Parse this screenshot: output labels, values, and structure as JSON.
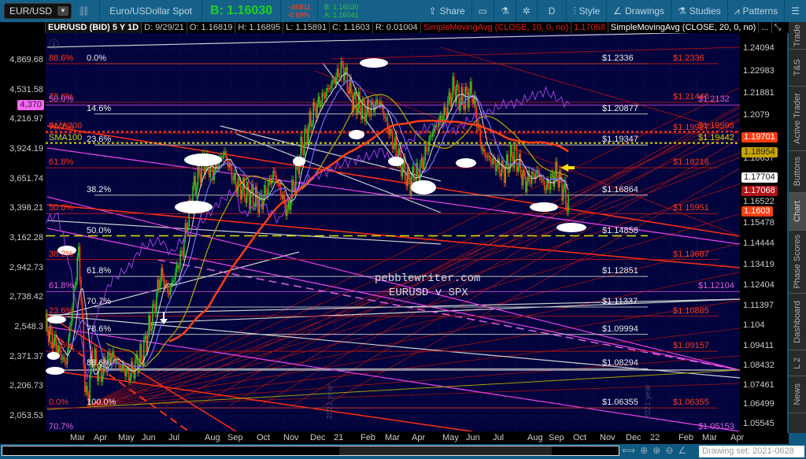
{
  "toolbar": {
    "symbol": "EUR/USD",
    "description": "Euro/USDollar Spot",
    "bid_big": "B: 1.16030",
    "change": "-.00811",
    "change_pct": "-0.69%",
    "bid_small": "B: 1.16030",
    "ask_small": "A: 1.16041",
    "share": "Share",
    "period": "D",
    "style": "Style",
    "drawings": "Drawings",
    "studies": "Studies",
    "patterns": "Patterns"
  },
  "infobar": {
    "title": "EUR/USD (BID) 5 Y 1D",
    "date": "D: 9/29/21",
    "open": "O: 1.16819",
    "high": "H: 1.16895",
    "low": "L: 1.15891",
    "close": "C: 1.1603",
    "range": "R: 0.01004",
    "sma10": "SimpleMovingAvg (CLOSE, 10, 0, no)",
    "sma10_value": "1.17068",
    "sma20": "SimpleMovingAvg (CLOSE, 20, 0, no)",
    "more": "..."
  },
  "left_axis": [
    "4,869.68",
    "4,531.58",
    "4,216.97",
    "3,924.19",
    "3,651.74",
    "3,398.21",
    "3,162.28",
    "2,942.73",
    "2,738.42",
    "2,548.3",
    "2,371.37",
    "2,206.73",
    "2,053.53"
  ],
  "left_tag": {
    "text": "4,370",
    "color": "#ff66ff"
  },
  "right_axis": [
    "1.24094",
    "1.22983",
    "1.21881",
    "1.2079",
    "1.18637",
    "1.16522",
    "1.15478",
    "1.14444",
    "1.13419",
    "1.12404",
    "1.11397",
    "1.104",
    "1.09411",
    "1.08432",
    "1.07461",
    "1.06499",
    "1.05545"
  ],
  "right_tags": [
    {
      "text": "1.19701",
      "color": "#ff3d14",
      "fg": "#fff"
    },
    {
      "text": "1.18954",
      "color": "#c9a400",
      "fg": "#222"
    },
    {
      "text": "1.17704",
      "color": "#ffffff",
      "fg": "#111"
    },
    {
      "text": "1.17068",
      "color": "#b0141a",
      "fg": "#fff"
    },
    {
      "text": "1.1603",
      "color": "#ff3d14",
      "fg": "#fff"
    }
  ],
  "white_fibs": [
    {
      "pct": "0.0%",
      "price": 1.2336,
      "label": "$1.2336"
    },
    {
      "pct": "14.6%",
      "price": 1.20877,
      "label": "$1.20877"
    },
    {
      "pct": "23.6%",
      "price": 1.19347,
      "label": "$1.19347"
    },
    {
      "pct": "38.2%",
      "price": 1.16864,
      "label": "$1.16864"
    },
    {
      "pct": "50.0%",
      "price": 1.14858,
      "label": "$1.14858"
    },
    {
      "pct": "61.8%",
      "price": 1.12851,
      "label": "$1.12851"
    },
    {
      "pct": "70.7%",
      "price": 1.11337,
      "label": "$1.11337"
    },
    {
      "pct": "78.6%",
      "price": 1.09994,
      "label": "$1.09994"
    },
    {
      "pct": "88.6%",
      "price": 1.08294,
      "label": "$1.08294"
    },
    {
      "pct": "100.0%",
      "price": 1.06355,
      "label": "$1.06355"
    }
  ],
  "red_fibs": [
    {
      "pct": "88.6%",
      "price": 1.2336,
      "label": "$1.2336"
    },
    {
      "pct": "78.6%",
      "price": 1.21448,
      "label": "$1.21448"
    },
    {
      "pct": "70.7%",
      "price": 1.19927,
      "label": "$1.19927"
    },
    {
      "pct": "61.8%",
      "price": 1.18216,
      "label": "$1.18216"
    },
    {
      "pct": "50.0%",
      "price": 1.15951,
      "label": "$1.15951"
    },
    {
      "pct": "38.2%",
      "price": 1.13687,
      "label": "$1.13687"
    },
    {
      "pct": "23.6%",
      "price": 1.10885,
      "label": "$1.10885"
    },
    {
      "pct": "14.6%",
      "price": 1.09157,
      "label": "$1.09157"
    },
    {
      "pct": "0.0%",
      "price": 1.06355,
      "label": "$1.06355"
    }
  ],
  "magenta_fibs": [
    {
      "pct": "50.0%",
      "price": 1.2132,
      "label": "$1.2132"
    },
    {
      "pct": "61.8%",
      "price": 1.12104,
      "label": "$1.12104"
    },
    {
      "pct": "70.7%",
      "price": 1.05153,
      "label": "$1.05153"
    }
  ],
  "sma_levels": [
    {
      "name": "SMA200",
      "price": 1.19995,
      "label": "$1.19995",
      "color": "#ff3d14"
    },
    {
      "name": "SMA100",
      "price": 1.19442,
      "label": "$1.19442",
      "color": "#d8d800"
    }
  ],
  "brand": {
    "site": "pebblewriter.com",
    "subtitle": "EURUSD v SPX"
  },
  "watermarks": [
    "2021 year",
    "2021 year"
  ],
  "months": [
    "Mar",
    "Apr",
    "May",
    "Jun",
    "Jul",
    "Aug",
    "Sep",
    "Oct",
    "Nov",
    "Dec",
    "21",
    "Feb",
    "Mar",
    "Apr",
    "May",
    "Jun",
    "Jul",
    "Aug",
    "Sep",
    "Oct",
    "Nov",
    "Dec",
    "22",
    "Feb",
    "Mar",
    "Apr"
  ],
  "tabs": [
    {
      "label": "Trade",
      "selected": false
    },
    {
      "label": "T&S",
      "selected": false
    },
    {
      "label": "Active Trader",
      "selected": false
    },
    {
      "label": "Buttons",
      "selected": false
    },
    {
      "label": "Chart",
      "selected": true
    },
    {
      "label": "Phase Scores",
      "selected": false
    },
    {
      "label": "Dashboard",
      "selected": false
    },
    {
      "label": "L 2",
      "selected": false
    },
    {
      "label": "News",
      "selected": false
    }
  ],
  "footer": {
    "drawing_set": "Drawing set: 2021-0628"
  },
  "chart_data": {
    "type": "line",
    "title": "EUR/USD (BID) 5 Y 1D",
    "x_unit": "months since Mar 2020",
    "eurusd_keypoints": [
      [
        -1.2,
        1.105
      ],
      [
        -0.8,
        1.095
      ],
      [
        -0.4,
        1.085
      ],
      [
        -0.1,
        1.12
      ],
      [
        0.1,
        1.142
      ],
      [
        0.3,
        1.08
      ],
      [
        0.4,
        1.065
      ],
      [
        0.6,
        1.09
      ],
      [
        0.9,
        1.08
      ],
      [
        1.3,
        1.09
      ],
      [
        1.6,
        1.085
      ],
      [
        2.0,
        1.08
      ],
      [
        2.5,
        1.09
      ],
      [
        2.9,
        1.11
      ],
      [
        3.2,
        1.13
      ],
      [
        3.5,
        1.12
      ],
      [
        4.0,
        1.14
      ],
      [
        4.4,
        1.17
      ],
      [
        4.8,
        1.185
      ],
      [
        5.2,
        1.18
      ],
      [
        5.6,
        1.19
      ],
      [
        6.0,
        1.175
      ],
      [
        6.4,
        1.17
      ],
      [
        7.0,
        1.165
      ],
      [
        7.5,
        1.18
      ],
      [
        8.0,
        1.16
      ],
      [
        8.5,
        1.19
      ],
      [
        9.0,
        1.21
      ],
      [
        9.5,
        1.22
      ],
      [
        10.1,
        1.232
      ],
      [
        10.5,
        1.215
      ],
      [
        11,
        1.21
      ],
      [
        11.5,
        1.215
      ],
      [
        12,
        1.195
      ],
      [
        12.6,
        1.175
      ],
      [
        13,
        1.18
      ],
      [
        13.5,
        1.2
      ],
      [
        14,
        1.21
      ],
      [
        14.3,
        1.222
      ],
      [
        14.6,
        1.215
      ],
      [
        15,
        1.22
      ],
      [
        15.4,
        1.19
      ],
      [
        15.8,
        1.185
      ],
      [
        16.2,
        1.18
      ],
      [
        16.6,
        1.19
      ],
      [
        17.0,
        1.175
      ],
      [
        17.5,
        1.18
      ],
      [
        17.8,
        1.172
      ],
      [
        18.2,
        1.18
      ],
      [
        18.5,
        1.17
      ],
      [
        18.7,
        1.1603
      ]
    ],
    "spx_keypoints": [
      [
        -1.2,
        3300
      ],
      [
        -0.7,
        3350
      ],
      [
        -0.3,
        3000
      ],
      [
        0.2,
        2500
      ],
      [
        0.4,
        2240
      ],
      [
        0.7,
        2600
      ],
      [
        1.3,
        2850
      ],
      [
        2,
        2950
      ],
      [
        2.5,
        3100
      ],
      [
        3.2,
        3150
      ],
      [
        3.6,
        3050
      ],
      [
        4.2,
        3200
      ],
      [
        4.8,
        3300
      ],
      [
        5.4,
        3450
      ],
      [
        6.0,
        3550
      ],
      [
        6.3,
        3350
      ],
      [
        7.0,
        3450
      ],
      [
        7.7,
        3300
      ],
      [
        8.2,
        3550
      ],
      [
        8.8,
        3650
      ],
      [
        9.5,
        3720
      ],
      [
        10.2,
        3800
      ],
      [
        11,
        3850
      ],
      [
        11.6,
        3920
      ],
      [
        12,
        3800
      ],
      [
        12.5,
        3970
      ],
      [
        13.2,
        4130
      ],
      [
        13.8,
        4180
      ],
      [
        14.3,
        4100
      ],
      [
        14.8,
        4200
      ],
      [
        15.5,
        4280
      ],
      [
        16.2,
        4380
      ],
      [
        16.8,
        4400
      ],
      [
        17.3,
        4470
      ],
      [
        17.8,
        4520
      ],
      [
        18.2,
        4450
      ],
      [
        18.7,
        4370
      ]
    ]
  }
}
